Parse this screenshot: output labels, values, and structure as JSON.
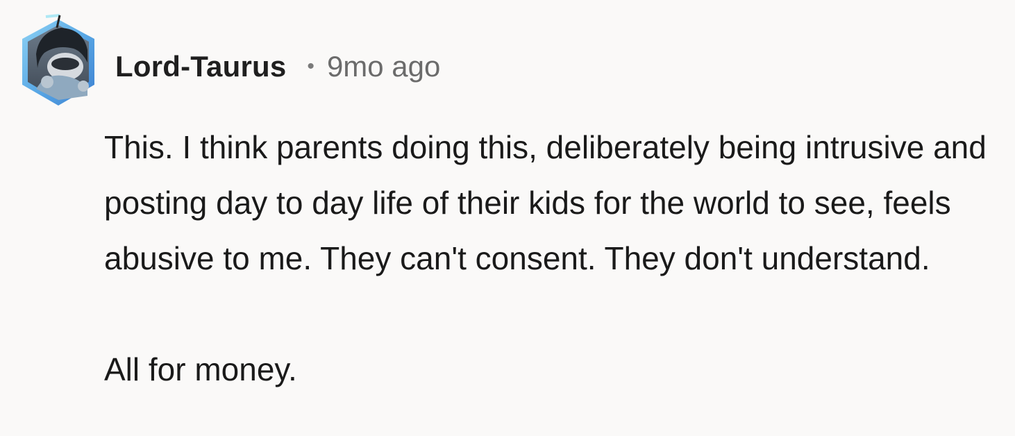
{
  "comment": {
    "author": "Lord-Taurus",
    "separator": "•",
    "timestamp": "9mo ago",
    "paragraphs": [
      "This. I think parents doing this, deliberately being intrusive and posting day to day life of their kids for the world to see, feels abusive to me. They can't consent. They don't understand.",
      "All for money."
    ]
  }
}
